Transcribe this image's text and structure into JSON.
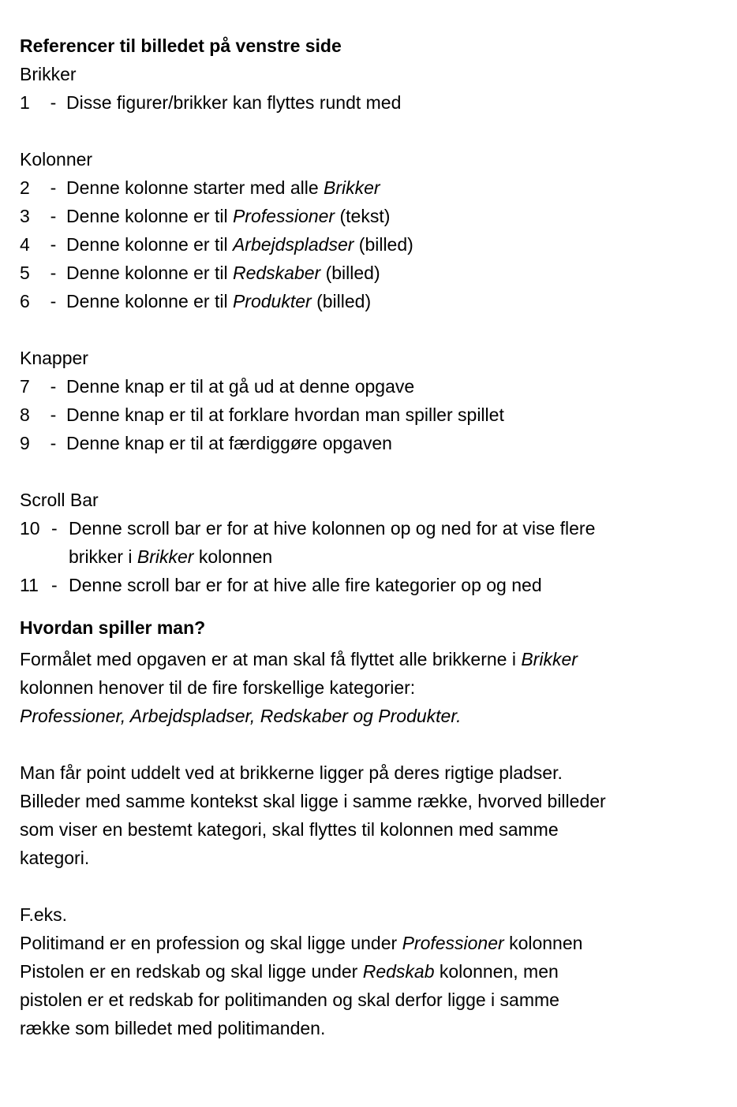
{
  "references": {
    "title": "Referencer til billedet på venstre side",
    "brikker_label": "Brikker",
    "item1": {
      "num": "1",
      "dash": "-",
      "text": "Disse figurer/brikker kan flyttes rundt med"
    },
    "kolonner_label": "Kolonner",
    "item2": {
      "num": "2",
      "dash": "-",
      "pre": "Denne kolonne starter med alle ",
      "em": "Brikker",
      "post": ""
    },
    "item3": {
      "num": "3",
      "dash": "-",
      "pre": "Denne kolonne er til ",
      "em": "Professioner",
      "post": " (tekst)"
    },
    "item4": {
      "num": "4",
      "dash": "-",
      "pre": "Denne kolonne er til ",
      "em": "Arbejdspladser",
      "post": " (billed)"
    },
    "item5": {
      "num": "5",
      "dash": "-",
      "pre": "Denne kolonne er til ",
      "em": "Redskaber",
      "post": " (billed)"
    },
    "item6": {
      "num": "6",
      "dash": "-",
      "pre": "Denne kolonne er til ",
      "em": "Produkter",
      "post": " (billed)"
    },
    "knapper_label": "Knapper",
    "item7": {
      "num": "7",
      "dash": "-",
      "text": "Denne knap er til at gå ud at denne opgave"
    },
    "item8": {
      "num": "8",
      "dash": "-",
      "text": "Denne knap er til at forklare hvordan man spiller spillet"
    },
    "item9": {
      "num": "9",
      "dash": "-",
      "text": "Denne knap er til at færdiggøre opgaven"
    },
    "scrollbar_label": "Scroll Bar",
    "item10": {
      "num": "10",
      "dash": "-",
      "line1": "Denne scroll bar er for at hive kolonnen op og ned for at vise flere",
      "line2_pre": "brikker i ",
      "line2_em": "Brikker",
      "line2_post": " kolonnen"
    },
    "item11": {
      "num": "11",
      "dash": "-",
      "text": "Denne scroll bar er for at hive alle fire kategorier op og ned"
    }
  },
  "howto": {
    "title": "Hvordan spiller man?",
    "p1_line1_pre": "Formålet med opgaven er at man skal få flyttet alle brikkerne i ",
    "p1_line1_em": "Brikker",
    "p1_line2": "kolonnen henover til de fire forskellige kategorier:",
    "p1_line3_em": "Professioner, Arbejdspladser, Redskaber og Produkter.",
    "p2_line1": "Man får point uddelt ved at brikkerne ligger på deres rigtige pladser.",
    "p2_line2": "Billeder med samme kontekst skal ligge i samme række, hvorved billeder",
    "p2_line3": "som viser en bestemt kategori, skal flyttes til kolonnen med samme",
    "p2_line4": "kategori.",
    "p3_line1": "F.eks.",
    "p3_line2_pre": "Politimand er en profession og skal ligge under ",
    "p3_line2_em": "Professioner",
    "p3_line2_post": " kolonnen",
    "p3_line3_pre": "Pistolen er en redskab og skal ligge under ",
    "p3_line3_em": "Redskab",
    "p3_line3_post": " kolonnen, men",
    "p3_line4": "pistolen er et redskab for politimanden og skal derfor ligge i samme",
    "p3_line5": "række som billedet med politimanden."
  }
}
